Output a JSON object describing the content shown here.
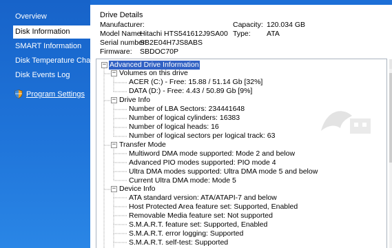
{
  "sidebar": {
    "items": [
      {
        "label": "Overview"
      },
      {
        "label": "Disk Information"
      },
      {
        "label": "SMART Information"
      },
      {
        "label": "Disk Temperature Chart"
      },
      {
        "label": "Disk Events Log"
      }
    ],
    "settings_label": "Program Settings",
    "settings_icon": "shield-icon"
  },
  "drive_details": {
    "title": "Drive Details",
    "manufacturer_label": "Manufacturer:",
    "manufacturer_value": "",
    "model_label": "Model Name:",
    "model_value": "Hitachi HTS541612J9SA00",
    "serial_label": "Serial number:",
    "serial_value": "SB2E04H7JS8ABS",
    "firmware_label": "Firmware:",
    "firmware_value": "SBDOC70P",
    "capacity_label": "Capacity:",
    "capacity_value": "120.034 GB",
    "type_label": "Type:",
    "type_value": "ATA"
  },
  "tree": {
    "root": "Advanced Drive Information",
    "volumes": {
      "label": "Volumes on this drive",
      "items": [
        "ACER (C:) - Free: 15.88 / 51.14 Gb [32%]",
        "DATA (D:) - Free: 4.43 / 50.89 Gb [9%]"
      ]
    },
    "drive_info": {
      "label": "Drive Info",
      "items": [
        "Number of LBA Sectors: 234441648",
        "Number of logical cylinders: 16383",
        "Number of logical heads: 16",
        "Number of logical sectors per logical track: 63"
      ]
    },
    "transfer_mode": {
      "label": "Transfer Mode",
      "items": [
        "Multiword DMA mode supported: Mode 2 and below",
        "Advanced PIO modes supported: PIO mode 4",
        "Ultra DMA modes supported: Ultra DMA mode 5 and below",
        "Current Ultra DMA mode: Mode 5"
      ]
    },
    "device_info": {
      "label": "Device Info",
      "items": [
        "ATA standard version: ATA/ATAPI-7 and below",
        "Host Protected Area feature set: Supported, Enabled",
        "Removable Media feature set: Not supported",
        "S.M.A.R.T. feature set: Supported, Enabled",
        "S.M.A.R.T. error logging: Supported",
        "S.M.A.R.T. self-test: Supported"
      ]
    }
  },
  "colors": {
    "sidebar_blue": "#1f74d9",
    "selection": "#3161c4"
  }
}
